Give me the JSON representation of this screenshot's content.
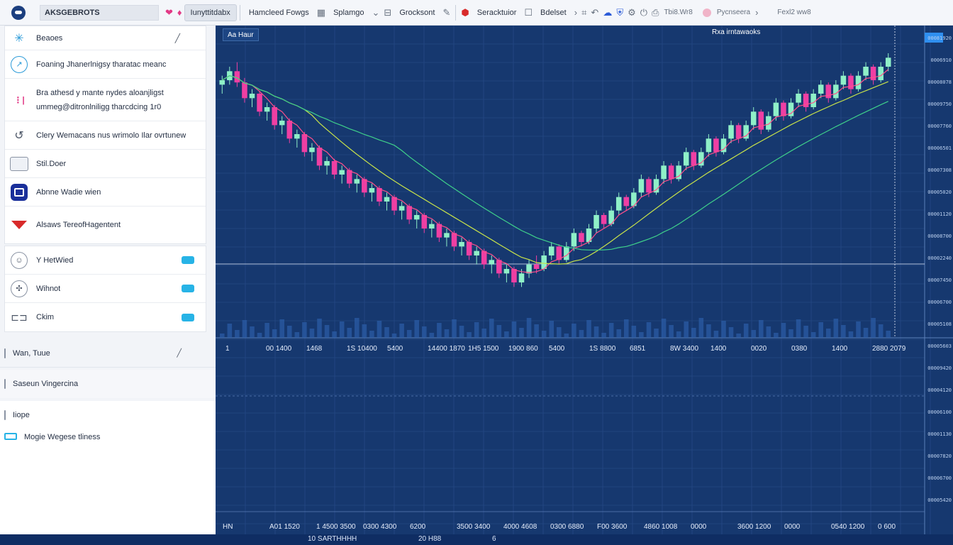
{
  "toolbar": {
    "brand_label": "AKSGEBROTS",
    "tabs": [
      "Iunyttitdabx",
      "Hamcleed Fowgs",
      "Splamgo",
      "Grocksont",
      "Seracktuior",
      "Bdelset"
    ],
    "right_text": "Tbi8.Wr8",
    "account_text": "Pycnseera",
    "far_right_text": "Fexl2 ww8"
  },
  "sidebar": {
    "top_items": [
      {
        "label": "Beaoes",
        "icon": "star-icon"
      },
      {
        "label": "Foaning Jhanerlnigsy tharatac meanc",
        "icon": "chart-icon"
      },
      {
        "label": "Bra athesd y mante nydes aloanjligst\nummeg@ditronlniligg tharcdcing 1r0",
        "icon": "bars-icon"
      },
      {
        "label": "Clery Wemacans nus wrimolo Ilar ovrtunew",
        "icon": "refresh-icon"
      },
      {
        "label": "Stil.Doer",
        "icon": "box-icon"
      },
      {
        "label": "Abnne Wadie wien",
        "icon": "navy-icon"
      },
      {
        "label": "Alsaws TereofHagentent",
        "icon": "warning-icon"
      }
    ],
    "toggle_items": [
      {
        "label": "Y HetWied",
        "icon": "user-icon"
      },
      {
        "label": "Wihnot",
        "icon": "settings-icon"
      },
      {
        "label": "Ckim",
        "icon": "link-icon"
      }
    ],
    "lower_items": [
      {
        "label": "Wan, Tuue",
        "icon": "window-icon"
      },
      {
        "label": "Saseun Vingercina",
        "icon": "panel-icon"
      },
      {
        "label": "Iiope",
        "icon": "tag-icon"
      },
      {
        "label": "Mogie Wegese tliness",
        "icon": "card-icon"
      }
    ]
  },
  "chart": {
    "tag_left": "Aa Haur",
    "tag_right": "Rxa irntawaoks",
    "price_labels": [
      "00081920",
      "0006910",
      "00008078",
      "00009750",
      "00007760",
      "00006501",
      "00007308",
      "00005020",
      "00001120",
      "00008700",
      "00002240",
      "00007450",
      "00006700",
      "00005108",
      "00005603",
      "00009420",
      "00004120",
      "00006100",
      "00001130",
      "00007820",
      "00006700",
      "00005420"
    ],
    "mid_axis_labels": [
      "1",
      "00 1400",
      "1468",
      "1S 10400",
      "5400",
      "14400 1870",
      "1H5 1500",
      "1900 860",
      "5400",
      "1S 8800",
      "6851",
      "8W 3400",
      "1400",
      "0020",
      "0380",
      "1400",
      "2880 2079"
    ],
    "bottom_axis_labels": [
      "HN",
      "A01 1520",
      "1 4500 3500",
      "0300 4300",
      "6200",
      "3500 3400",
      "4000 4608",
      "0300 6880",
      "F00 3600",
      "4860 1008",
      "0000",
      "3600 1200",
      "0000",
      "0540 1200",
      "0 600"
    ]
  },
  "status": {
    "items": [
      "10 SARTHHHH",
      "20 H88",
      "6"
    ]
  },
  "chart_data": {
    "type": "line",
    "title": "",
    "candles": [
      [
        100,
        104,
        96,
        102
      ],
      [
        102,
        108,
        100,
        106
      ],
      [
        106,
        110,
        99,
        101
      ],
      [
        101,
        103,
        92,
        94
      ],
      [
        94,
        98,
        90,
        96
      ],
      [
        96,
        97,
        86,
        88
      ],
      [
        88,
        92,
        84,
        90
      ],
      [
        90,
        91,
        80,
        82
      ],
      [
        82,
        86,
        78,
        84
      ],
      [
        84,
        85,
        74,
        76
      ],
      [
        76,
        80,
        72,
        78
      ],
      [
        78,
        79,
        68,
        70
      ],
      [
        70,
        74,
        66,
        72
      ],
      [
        72,
        73,
        62,
        64
      ],
      [
        64,
        68,
        60,
        66
      ],
      [
        66,
        67,
        58,
        60
      ],
      [
        60,
        64,
        56,
        62
      ],
      [
        62,
        63,
        54,
        56
      ],
      [
        56,
        60,
        52,
        58
      ],
      [
        58,
        59,
        50,
        52
      ],
      [
        52,
        56,
        48,
        54
      ],
      [
        54,
        55,
        46,
        48
      ],
      [
        48,
        52,
        44,
        50
      ],
      [
        50,
        51,
        42,
        44
      ],
      [
        44,
        48,
        40,
        46
      ],
      [
        46,
        47,
        38,
        40
      ],
      [
        40,
        44,
        36,
        42
      ],
      [
        42,
        43,
        34,
        36
      ],
      [
        36,
        40,
        32,
        38
      ],
      [
        38,
        39,
        30,
        32
      ],
      [
        32,
        36,
        28,
        34
      ],
      [
        34,
        35,
        26,
        28
      ],
      [
        28,
        32,
        24,
        30
      ],
      [
        30,
        31,
        22,
        24
      ],
      [
        24,
        28,
        20,
        26
      ],
      [
        26,
        27,
        18,
        20
      ],
      [
        20,
        24,
        16,
        22
      ],
      [
        22,
        23,
        14,
        16
      ],
      [
        16,
        20,
        12,
        18
      ],
      [
        18,
        19,
        10,
        12
      ],
      [
        12,
        18,
        10,
        16
      ],
      [
        16,
        22,
        14,
        20
      ],
      [
        20,
        24,
        16,
        18
      ],
      [
        18,
        26,
        17,
        24
      ],
      [
        24,
        30,
        22,
        28
      ],
      [
        28,
        29,
        20,
        22
      ],
      [
        22,
        30,
        21,
        28
      ],
      [
        28,
        36,
        26,
        34
      ],
      [
        34,
        35,
        28,
        30
      ],
      [
        30,
        38,
        29,
        36
      ],
      [
        36,
        44,
        34,
        42
      ],
      [
        42,
        43,
        36,
        38
      ],
      [
        38,
        46,
        37,
        44
      ],
      [
        44,
        52,
        42,
        50
      ],
      [
        50,
        51,
        44,
        46
      ],
      [
        46,
        54,
        45,
        52
      ],
      [
        52,
        60,
        50,
        58
      ],
      [
        58,
        59,
        50,
        52
      ],
      [
        52,
        60,
        51,
        58
      ],
      [
        58,
        66,
        56,
        64
      ],
      [
        64,
        65,
        56,
        58
      ],
      [
        58,
        66,
        57,
        64
      ],
      [
        64,
        72,
        62,
        70
      ],
      [
        70,
        71,
        62,
        64
      ],
      [
        64,
        72,
        63,
        70
      ],
      [
        70,
        78,
        68,
        76
      ],
      [
        76,
        77,
        68,
        70
      ],
      [
        70,
        78,
        69,
        76
      ],
      [
        76,
        84,
        74,
        82
      ],
      [
        82,
        83,
        74,
        76
      ],
      [
        76,
        84,
        75,
        82
      ],
      [
        82,
        90,
        80,
        88
      ],
      [
        88,
        89,
        78,
        80
      ],
      [
        80,
        88,
        79,
        86
      ],
      [
        86,
        94,
        84,
        92
      ],
      [
        92,
        93,
        84,
        86
      ],
      [
        86,
        94,
        85,
        92
      ],
      [
        92,
        98,
        90,
        96
      ],
      [
        96,
        97,
        88,
        90
      ],
      [
        90,
        98,
        89,
        96
      ],
      [
        96,
        102,
        94,
        100
      ],
      [
        100,
        101,
        92,
        94
      ],
      [
        94,
        102,
        93,
        100
      ],
      [
        100,
        106,
        98,
        104
      ],
      [
        104,
        105,
        96,
        98
      ],
      [
        98,
        106,
        97,
        104
      ],
      [
        104,
        110,
        102,
        108
      ],
      [
        108,
        109,
        100,
        102
      ],
      [
        102,
        110,
        101,
        108
      ],
      [
        108,
        114,
        106,
        112
      ]
    ],
    "ylim": [
      0,
      120
    ]
  }
}
